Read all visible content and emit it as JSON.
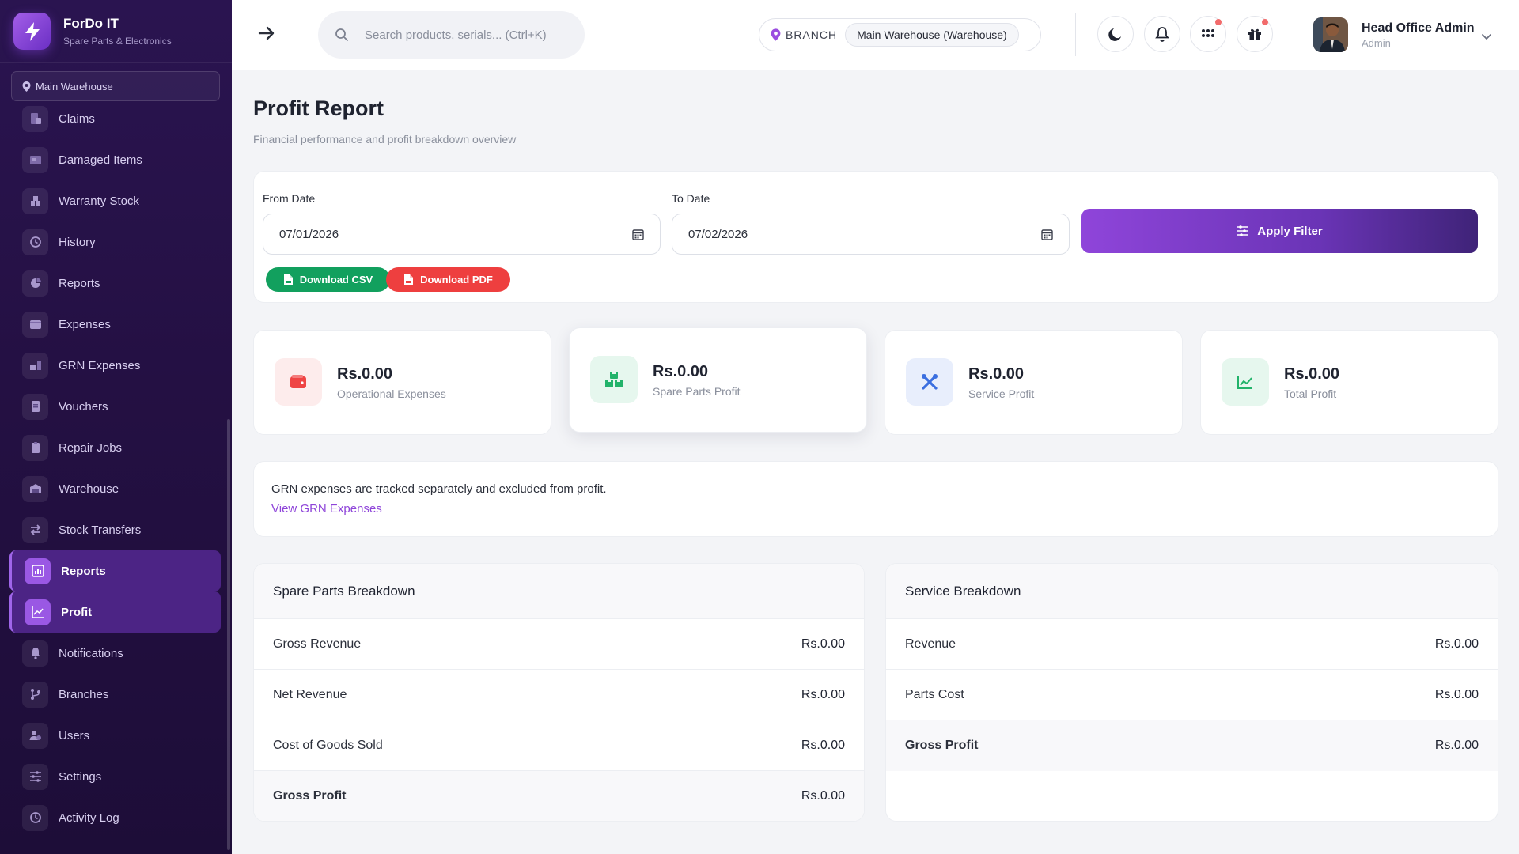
{
  "app": {
    "name": "ForDo IT",
    "subtitle": "Spare Parts & Electronics",
    "branch_pill": "Main Warehouse"
  },
  "sidebar": {
    "items": [
      {
        "label": "Claims",
        "icon": "claims-icon"
      },
      {
        "label": "Damaged Items",
        "icon": "damaged-icon"
      },
      {
        "label": "Warranty Stock",
        "icon": "warranty-icon"
      },
      {
        "label": "History",
        "icon": "history-icon"
      },
      {
        "label": "Reports",
        "icon": "pie-chart-icon"
      },
      {
        "label": "Expenses",
        "icon": "wallet-icon"
      },
      {
        "label": "GRN Expenses",
        "icon": "grn-icon"
      },
      {
        "label": "Vouchers",
        "icon": "voucher-icon"
      },
      {
        "label": "Repair Jobs",
        "icon": "clipboard-icon"
      },
      {
        "label": "Warehouse",
        "icon": "warehouse-icon"
      },
      {
        "label": "Stock Transfers",
        "icon": "transfer-icon"
      },
      {
        "label": "Reports",
        "icon": "bar-chart-icon",
        "active": true
      },
      {
        "label": "Profit",
        "icon": "line-chart-icon",
        "active": true
      },
      {
        "label": "Notifications",
        "icon": "bell-icon"
      },
      {
        "label": "Branches",
        "icon": "branch-icon"
      },
      {
        "label": "Users",
        "icon": "users-icon"
      },
      {
        "label": "Settings",
        "icon": "sliders-icon"
      },
      {
        "label": "Activity Log",
        "icon": "activity-icon"
      }
    ]
  },
  "header": {
    "search_placeholder": "Search products, serials... (Ctrl+K)",
    "branch_label": "BRANCH",
    "branch_value": "Main Warehouse (Warehouse)",
    "user_name": "Head Office Admin",
    "user_role": "Admin"
  },
  "page": {
    "title": "Profit Report",
    "subtitle": "Financial performance and profit breakdown overview"
  },
  "filter": {
    "from_label": "From Date",
    "from_value": "07/01/2026",
    "to_label": "To Date",
    "to_value": "07/02/2026",
    "apply_label": "Apply Filter",
    "csv_label": "Download CSV",
    "pdf_label": "Download PDF"
  },
  "stats": [
    {
      "value": "Rs.0.00",
      "label": "Operational Expenses",
      "icon": "wallet-icon",
      "color": "#ef4444",
      "bg": "#fdecec"
    },
    {
      "value": "Rs.0.00",
      "label": "Spare Parts Profit",
      "icon": "boxes-icon",
      "color": "#22b36a",
      "bg": "#e6f7ee"
    },
    {
      "value": "Rs.0.00",
      "label": "Service Profit",
      "icon": "tools-icon",
      "color": "#3b6fe0",
      "bg": "#e8eefc"
    },
    {
      "value": "Rs.0.00",
      "label": "Total Profit",
      "icon": "line-chart-icon",
      "color": "#22b36a",
      "bg": "#e6f7ee"
    }
  ],
  "note": {
    "text": "GRN expenses are tracked separately and excluded from profit.",
    "link": "View GRN Expenses"
  },
  "spare_parts": {
    "title": "Spare Parts Breakdown",
    "rows": [
      {
        "label": "Gross Revenue",
        "value": "Rs.0.00"
      },
      {
        "label": "Net Revenue",
        "value": "Rs.0.00"
      },
      {
        "label": "Cost of Goods Sold",
        "value": "Rs.0.00"
      },
      {
        "label": "Gross Profit",
        "value": "Rs.0.00"
      }
    ]
  },
  "service": {
    "title": "Service Breakdown",
    "rows": [
      {
        "label": "Revenue",
        "value": "Rs.0.00"
      },
      {
        "label": "Parts Cost",
        "value": "Rs.0.00"
      },
      {
        "label": "Gross Profit",
        "value": "Rs.0.00"
      }
    ]
  },
  "colors": {
    "accent": "#8e44d9",
    "sidebar_bg": "#241043",
    "csv_green": "#12a05e",
    "pdf_red": "#ee3f3f"
  }
}
